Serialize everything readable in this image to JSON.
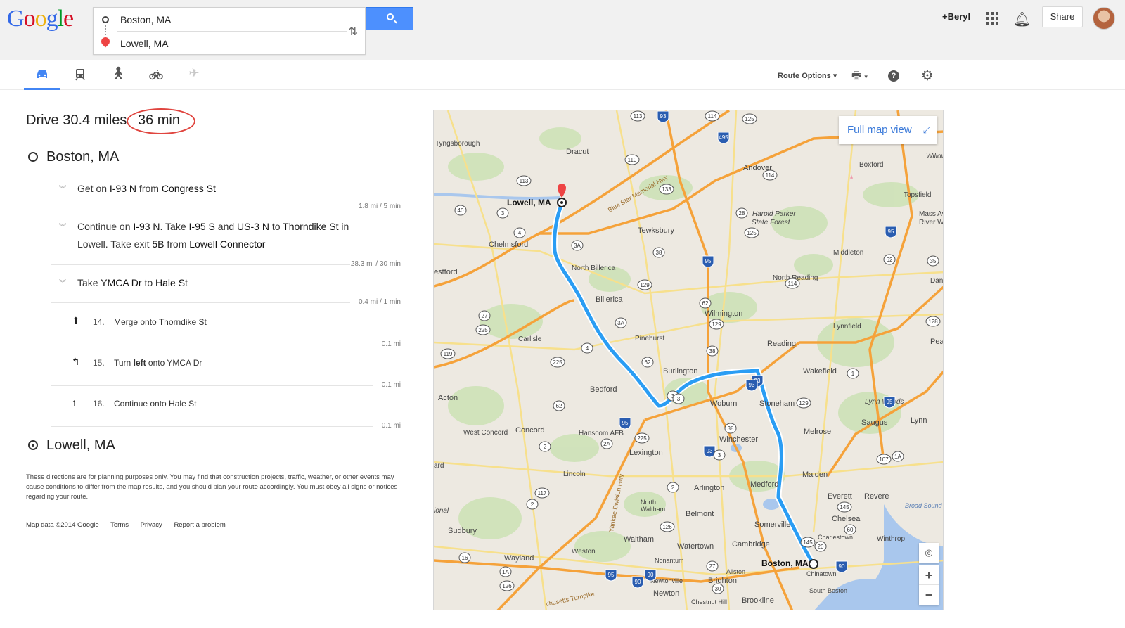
{
  "header": {
    "logo_letters": [
      {
        "ch": "G",
        "color": "#3369e8"
      },
      {
        "ch": "o",
        "color": "#d50f25"
      },
      {
        "ch": "o",
        "color": "#eeb211"
      },
      {
        "ch": "g",
        "color": "#3369e8"
      },
      {
        "ch": "l",
        "color": "#009925"
      },
      {
        "ch": "e",
        "color": "#d50f25"
      }
    ],
    "origin_value": "Boston, MA",
    "destination_value": "Lowell, MA",
    "user_name": "+Beryl",
    "share_label": "Share"
  },
  "modes": {
    "route_options_label": "Route Options"
  },
  "directions": {
    "summary_prefix": "Drive 30.4 miles",
    "summary_time": "36 min",
    "origin": "Boston, MA",
    "destination": "Lowell, MA",
    "steps": [
      {
        "dist": "1.8 mi / 5 min"
      },
      {
        "dist": "28.3 mi / 30 min"
      },
      {
        "dist": "0.4 mi / 1 min"
      }
    ],
    "substeps": [
      {
        "icon": "merge-icon",
        "num": "14.",
        "dist": "0.1 mi"
      },
      {
        "icon": "turn-left-icon",
        "num": "15.",
        "dist": "0.1 mi"
      },
      {
        "icon": "continue-straight-icon",
        "num": "16.",
        "dist": "0.1 mi"
      }
    ],
    "disclaimer": "These directions are for planning purposes only. You may find that construction projects, traffic, weather, or other events may cause conditions to differ from the map results, and you should plan your route accordingly. You must obey all signs or notices regarding your route.",
    "footer": {
      "map_data": "Map data ©2014 Google",
      "terms": "Terms",
      "privacy": "Privacy",
      "report": "Report a problem"
    }
  },
  "map": {
    "full_map_label": "Full map view",
    "route_color": "#2a9df4",
    "highway_color": "#f5a23a",
    "labels": {
      "lowell": "Lowell, MA",
      "boston": "Boston, MA",
      "tyngsborough": "Tyngsborough",
      "dracut": "Dracut",
      "andover": "Andover",
      "boxford": "Boxford",
      "topsfield": "Topsfield",
      "tewksbury": "Tewksbury",
      "chelmsford": "Chelmsford",
      "westford": "estford",
      "north_billerica": "North Billerica",
      "harold_parker": "Harold Parker",
      "state_forest": "State Forest",
      "middleton": "Middleton",
      "north_reading": "North Reading",
      "billerica": "Billerica",
      "wilmington": "Wilmington",
      "pinehurst": "Pinehurst",
      "carlisle": "Carlisle",
      "reading": "Reading",
      "lynnfield": "Lynnfield",
      "burlington": "Burlington",
      "wakefield": "Wakefield",
      "acton": "Acton",
      "bedford": "Bedford",
      "woburn": "Woburn",
      "stoneham": "Stoneham",
      "lynn_woods": "Lynn Woods",
      "saugus": "Saugus",
      "lynn": "Lynn",
      "west_concord": "West Concord",
      "concord": "Concord",
      "hanscom": "Hanscom AFB",
      "lexington": "Lexington",
      "winchester": "Winchester",
      "melrose": "Melrose",
      "lincoln": "Lincoln",
      "malden": "Malden",
      "arlington": "Arlington",
      "medford": "Medford",
      "everett": "Everett",
      "revere": "Revere",
      "north_waltham": "North",
      "waltham_label": "Waltham",
      "belmont": "Belmont",
      "somerville": "Somerville",
      "chelsea": "Chelsea",
      "broad_sound": "Broad Sound",
      "sudbury": "Sudbury",
      "waltham": "Waltham",
      "watertown": "Watertown",
      "cambridge": "Cambridge",
      "charlestown": "Charlestown",
      "winthrop": "Winthrop",
      "wayland": "Wayland",
      "weston": "Weston",
      "nonantum": "Nonantum",
      "allston": "Allston",
      "chinatown": "Chinatown",
      "newtonville": "Newtonville",
      "brighton": "Brighton",
      "newton": "Newton",
      "brookline": "Brookline",
      "south_boston": "South Boston",
      "chestnut_hill": "Chestnut Hill",
      "peal": "Peal",
      "danv": "Danv",
      "willow": "Willow",
      "mass_ave": "Mass Ave",
      "river_wil": "River Wil",
      "ard": "ard",
      "ional": "ional",
      "blue_star": "Blue Star Memorial Hwy",
      "yankee": "Yankee Division Hwy",
      "turnpike": "chusetts Turnpike"
    },
    "shields": [
      "113",
      "93",
      "114",
      "125",
      "495",
      "110",
      "113",
      "133",
      "114",
      "28",
      "40",
      "3",
      "4",
      "125",
      "95",
      "62",
      "3A",
      "38",
      "35",
      "95",
      "129",
      "114",
      "62",
      "27",
      "225",
      "3A",
      "129",
      "128",
      "93",
      "119",
      "38",
      "225",
      "4",
      "62",
      "3",
      "95",
      "1",
      "62",
      "93",
      "129",
      "95",
      "38",
      "2A",
      "225",
      "107",
      "1A",
      "2",
      "2",
      "3",
      "145",
      "117",
      "2",
      "126",
      "60",
      "145",
      "16",
      "20",
      "1A",
      "27",
      "90",
      "90",
      "95",
      "126",
      "30",
      "90",
      "93",
      "3"
    ]
  }
}
